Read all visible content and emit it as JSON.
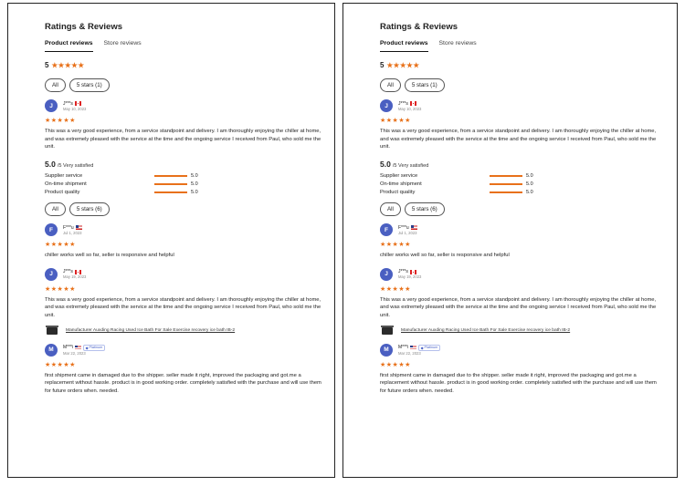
{
  "panels": [
    {
      "title": "Ratings & Reviews",
      "tabs": [
        "Product reviews",
        "Store reviews"
      ],
      "product_rating": "5",
      "product_stars": "★★★★★",
      "product_chips": [
        "All",
        "5 stars (1)"
      ],
      "product_review": {
        "avatar": "J",
        "name": "J***s",
        "flag": "canada-flag",
        "date": "May 10, 2023",
        "stars": "★★★★★",
        "text": "This was a very good experience, from a service standpoint and delivery. I am thoroughly enjoying the chiller at home, and was extremely pleased with the service at the time and the ongoing service I received from Paul, who sold me the unit."
      },
      "summary": {
        "score": "5.0",
        "label": "/5 Very satisfied",
        "metrics": [
          {
            "label": "Supplier service",
            "value": "5.0"
          },
          {
            "label": "On-time shipment",
            "value": "5.0"
          },
          {
            "label": "Product quality",
            "value": "5.0"
          }
        ]
      },
      "store_chips": [
        "All",
        "5 stars (6)"
      ],
      "store_reviews": [
        {
          "avatar": "F",
          "name": "F***u",
          "flag": "us-flag",
          "date": "Jul 1, 2023",
          "stars": "★★★★★",
          "text": "chiller works well so far, seller is responsive and helpful"
        },
        {
          "avatar": "J",
          "name": "J***s",
          "flag": "canada-flag",
          "date": "May 19, 2023",
          "stars": "★★★★★",
          "text": "This was a very good experience, from a service standpoint and delivery. I am thoroughly enjoying the chiller at home, and was extremely pleased with the service at the time and the ongoing service I received from Paul, who sold me the unit.",
          "product_link": "Manufacturer Auxding Racing Used Ice Bath For Sale Exercise recovery ice bath IB-2"
        },
        {
          "avatar": "M",
          "name": "M***i",
          "flag": "us-flag",
          "badge": "Platinum",
          "date": "Mar 22, 2023",
          "stars": "★★★★★",
          "text": "first shipment came in damaged due to the shipper. seller made it right, improved the packaging and got.me a replacement without hassle. product is in good working order. completely satisfied with the purchase and will use them for future orders when. needed."
        }
      ]
    },
    {
      "title": "Ratings & Reviews",
      "tabs": [
        "Product reviews",
        "Store reviews"
      ],
      "product_rating": "5",
      "product_stars": "★★★★★",
      "product_chips": [
        "All",
        "5 stars (1)"
      ],
      "product_review": {
        "avatar": "J",
        "name": "J***s",
        "flag": "canada-flag",
        "date": "May 10, 2023",
        "stars": "★★★★★",
        "text": "This was a very good experience, from a service standpoint and delivery. I am thoroughly enjoying the chiller at home, and was extremely pleased with the service at the time and the ongoing service I received from Paul, who sold me the unit."
      },
      "summary": {
        "score": "5.0",
        "label": "/5 Very satisfied",
        "metrics": [
          {
            "label": "Supplier service",
            "value": "5.0"
          },
          {
            "label": "On-time shipment",
            "value": "5.0"
          },
          {
            "label": "Product quality",
            "value": "5.0"
          }
        ]
      },
      "store_chips": [
        "All",
        "5 stars (6)"
      ],
      "store_reviews": [
        {
          "avatar": "F",
          "name": "F***u",
          "flag": "us-flag",
          "date": "Jul 1, 2023",
          "stars": "★★★★★",
          "text": "chiller works well so far, seller is responsive and helpful"
        },
        {
          "avatar": "J",
          "name": "J***s",
          "flag": "canada-flag",
          "date": "May 19, 2023",
          "stars": "★★★★★",
          "text": "This was a very good experience, from a service standpoint and delivery. I am thoroughly enjoying the chiller at home, and was extremely pleased with the service at the time and the ongoing service I received from Paul, who sold me the unit.",
          "product_link": "Manufacturer Auxding Racing Used Ice Bath For Sale Exercise recovery ice bath IB-2"
        },
        {
          "avatar": "M",
          "name": "M***i",
          "flag": "us-flag",
          "badge": "Platinum",
          "date": "Mar 22, 2023",
          "stars": "★★★★★",
          "text": "first shipment came in damaged due to the shipper. seller made it right, improved the packaging and got.me a replacement without hassle. product is in good working order. completely satisfied with the purchase and will use them for future orders when. needed."
        }
      ]
    }
  ]
}
